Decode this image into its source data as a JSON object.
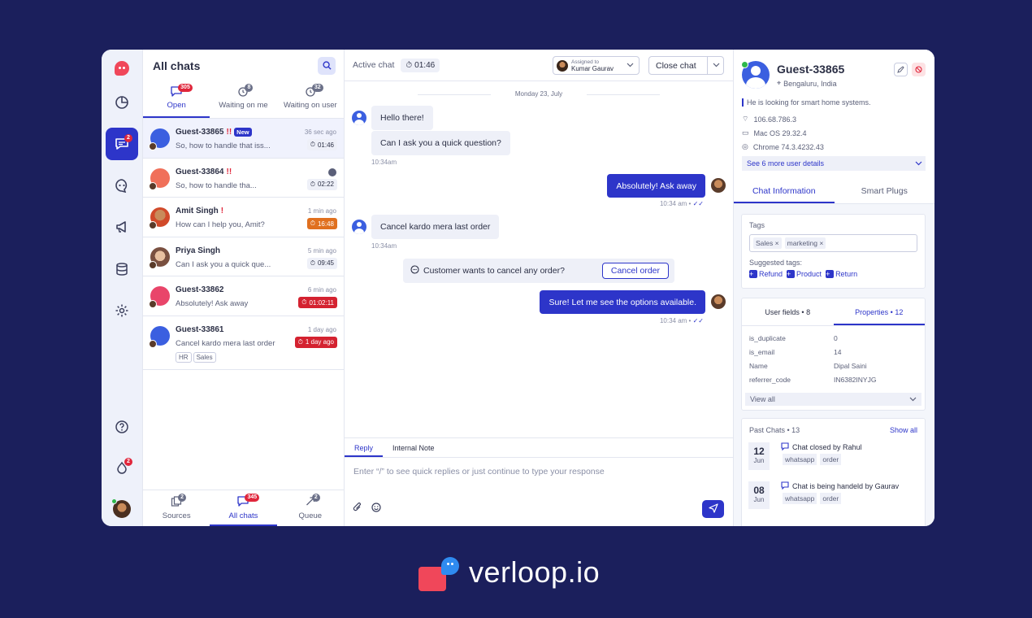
{
  "sidebar": {
    "chats_badge": "2",
    "alerts_badge": "2",
    "icons": [
      "logo-icon",
      "reports-icon",
      "chats-icon",
      "bots-icon",
      "campaigns-icon",
      "database-icon",
      "settings-icon",
      "help-icon",
      "notifications-icon",
      "avatar"
    ]
  },
  "list": {
    "title": "All chats",
    "tabs": [
      {
        "label": "Open",
        "count": "305"
      },
      {
        "label": "Waiting on me",
        "count": "8"
      },
      {
        "label": "Waiting on user",
        "count": "32"
      }
    ],
    "items": [
      {
        "name": "Guest-33865",
        "flag": "!!",
        "new": "New",
        "msg": "So, how to handle that iss...",
        "time": "36 sec ago",
        "timer": "01:46"
      },
      {
        "name": "Guest-33864",
        "flag": "!!",
        "msg": "So, how to handle tha...",
        "time": "",
        "timer": "02:22"
      },
      {
        "name": "Amit Singh",
        "flag": "!",
        "msg": "How can I help you, Amit?",
        "time": "1 min ago",
        "timer": "16:48"
      },
      {
        "name": "Priya Singh",
        "msg": "Can I ask you a quick que...",
        "time": "5 min ago",
        "timer": "09:45"
      },
      {
        "name": "Guest-33862",
        "msg": "Absolutely! Ask away",
        "time": "6 min ago",
        "timer": "01:02:11"
      },
      {
        "name": "Guest-33861",
        "msg": "Cancel kardo mera last order",
        "time": "1 day ago",
        "timer": "1 day ago",
        "tags": [
          "HR",
          "Sales"
        ]
      }
    ],
    "bottom_nav": [
      {
        "label": "Sources",
        "count": "2"
      },
      {
        "label": "All chats",
        "count": "345"
      },
      {
        "label": "Queue",
        "count": "2"
      }
    ]
  },
  "chat": {
    "active_label": "Active chat",
    "timer": "01:46",
    "assigned_label": "Assigned to",
    "assigned_name": "Kumar Gaurav",
    "close_label": "Close chat",
    "date": "Monday 23, July",
    "messages": [
      {
        "text": "Hello there!"
      },
      {
        "text": "Can I ask you a quick question?",
        "time": "10:34am"
      },
      {
        "text": "Absolutely! Ask away",
        "time": "10:34 am •"
      },
      {
        "text": "Cancel kardo mera last order",
        "time": "10:34am"
      },
      {
        "text": "Sure! Let me see the options available.",
        "time": "10:34 am •"
      }
    ],
    "system_text": "Customer wants to cancel any order?",
    "cancel_btn": "Cancel order",
    "reply_tab": "Reply",
    "note_tab": "Internal Note",
    "compose_placeholder": "Enter “/” to see quick replies or just continue to type your response"
  },
  "profile": {
    "name": "Guest-33865",
    "location": "Bengaluru, India",
    "about": "He is looking for smart home systems.",
    "ip": "106.68.786.3",
    "os": "Mac OS 29.32.4",
    "browser": "Chrome 74.3.4232.43",
    "see_more": "See 6 more user details",
    "tab_info": "Chat Information",
    "tab_plugs": "Smart Plugs",
    "tags_label": "Tags",
    "tags": [
      "Sales",
      "marketing"
    ],
    "suggested_label": "Suggested tags:",
    "suggested": [
      "Refund",
      "Product",
      "Return"
    ],
    "ptab_user": "User fields • 8",
    "ptab_props": "Properties • 12",
    "props": [
      {
        "k": "is_duplicate",
        "v": "0"
      },
      {
        "k": "is_email",
        "v": "14"
      },
      {
        "k": "Name",
        "v": "Dipal Saini"
      },
      {
        "k": "referrer_code",
        "v": "IN6382INYJG"
      }
    ],
    "view_all": "View all",
    "past_label": "Past Chats • 13",
    "show_all": "Show all",
    "past": [
      {
        "day": "12",
        "month": "Jun",
        "title": "Chat closed by Rahul",
        "tags": [
          "whatsapp",
          "order"
        ]
      },
      {
        "day": "08",
        "month": "Jun",
        "title": "Chat is being handeld by Gaurav",
        "tags": [
          "whatsapp",
          "order"
        ]
      }
    ]
  },
  "brand": {
    "text": "verloop.io"
  },
  "colors": {
    "accent": "#2d35c9",
    "alert": "#e0263b",
    "background": "#1b1f5c"
  }
}
